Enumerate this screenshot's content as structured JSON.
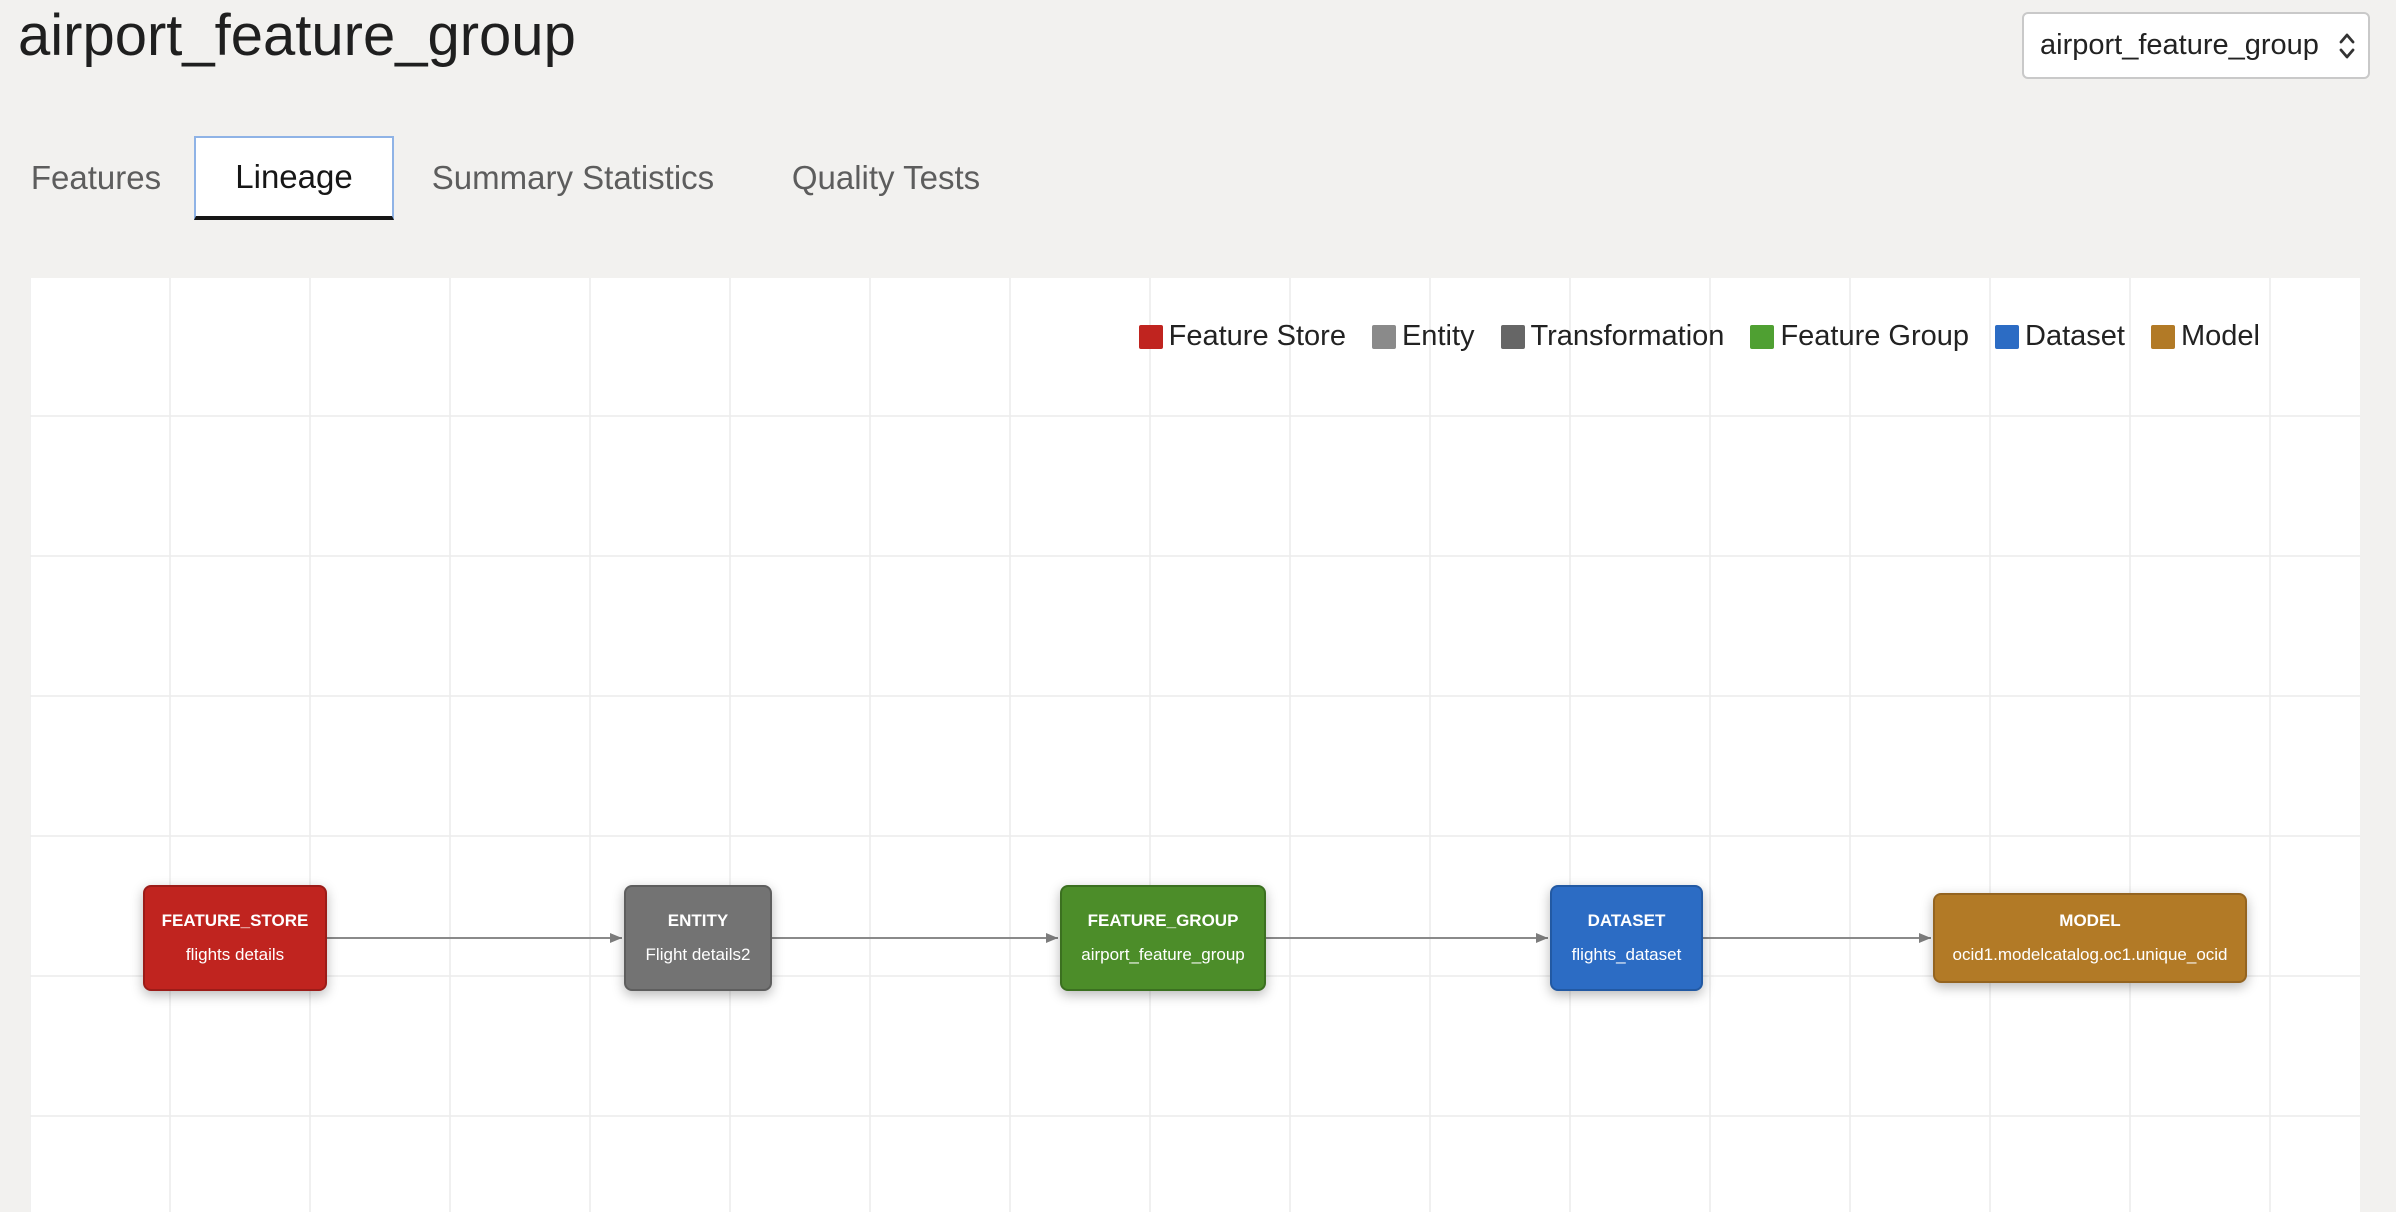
{
  "page": {
    "title": "airport_feature_group"
  },
  "selector": {
    "value": "airport_feature_group",
    "icon": "updown-chevron-icon"
  },
  "tabs": [
    {
      "label": "Features",
      "active": false
    },
    {
      "label": "Lineage",
      "active": true
    },
    {
      "label": "Summary Statistics",
      "active": false
    },
    {
      "label": "Quality Tests",
      "active": false
    }
  ],
  "legend": [
    {
      "label": "Feature Store",
      "color": "#c0241f"
    },
    {
      "label": "Entity",
      "color": "#8a8a8a"
    },
    {
      "label": "Transformation",
      "color": "#666666"
    },
    {
      "label": "Feature Group",
      "color": "#4fa032"
    },
    {
      "label": "Dataset",
      "color": "#2c6cc4"
    },
    {
      "label": "Model",
      "color": "#b27a26"
    }
  ],
  "nodes": [
    {
      "type": "FEATURE_STORE",
      "name": "flights details",
      "color": "#c0241f",
      "border": "#9c1c18"
    },
    {
      "type": "ENTITY",
      "name": "Flight details2",
      "color": "#737373",
      "border": "#5e5e5e"
    },
    {
      "type": "FEATURE_GROUP",
      "name": "airport_feature_group",
      "color": "#4c8d29",
      "border": "#3b7020"
    },
    {
      "type": "DATASET",
      "name": "flights_dataset",
      "color": "#2c6cc4",
      "border": "#2259a3"
    },
    {
      "type": "MODEL",
      "name": "ocid1.modelcatalog.oc1.unique_ocid",
      "color": "#b27a26",
      "border": "#946420"
    }
  ],
  "edge_color": "#8a8a8a"
}
